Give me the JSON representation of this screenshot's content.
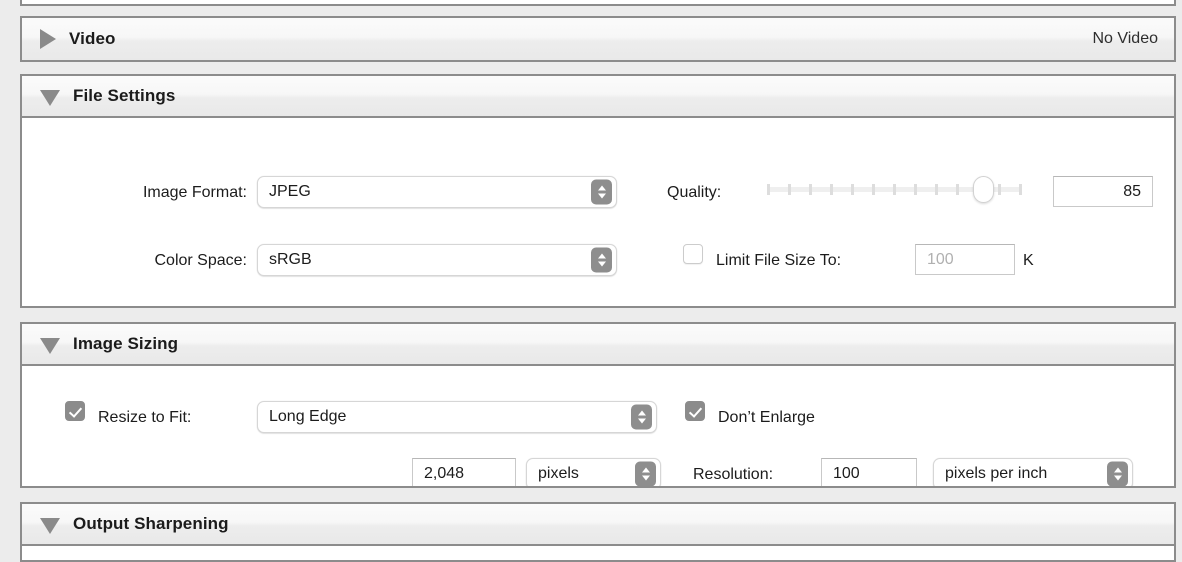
{
  "window": {
    "background_color": "#ececec",
    "panel_border_color": "#8c8c8c"
  },
  "panels": [
    {
      "id": "video",
      "title": "Video",
      "disclosure": "collapsed",
      "status": "No Video"
    },
    {
      "id": "file_settings",
      "title": "File Settings",
      "disclosure": "expanded"
    },
    {
      "id": "image_sizing",
      "title": "Image Sizing",
      "disclosure": "expanded"
    },
    {
      "id": "output_sharpening",
      "title": "Output Sharpening",
      "disclosure": "expanded"
    }
  ],
  "file_settings": {
    "image_format": {
      "label": "Image Format:",
      "value": "JPEG"
    },
    "color_space": {
      "label": "Color Space:",
      "value": "sRGB"
    },
    "quality": {
      "label": "Quality:",
      "value": "85",
      "min": 0,
      "max": 100,
      "tick_count": 13
    },
    "limit_file_size": {
      "label": "Limit File Size To:",
      "checked": false,
      "value": "",
      "placeholder": "100",
      "unit": "K"
    }
  },
  "image_sizing": {
    "resize_to_fit": {
      "label": "Resize to Fit:",
      "checked": true,
      "value": "Long Edge"
    },
    "dont_enlarge": {
      "label": "Don’t Enlarge",
      "checked": true
    },
    "dimension": {
      "value": "2,048",
      "unit": "pixels"
    },
    "resolution": {
      "label": "Resolution:",
      "value": "100",
      "unit": "pixels per inch"
    }
  }
}
